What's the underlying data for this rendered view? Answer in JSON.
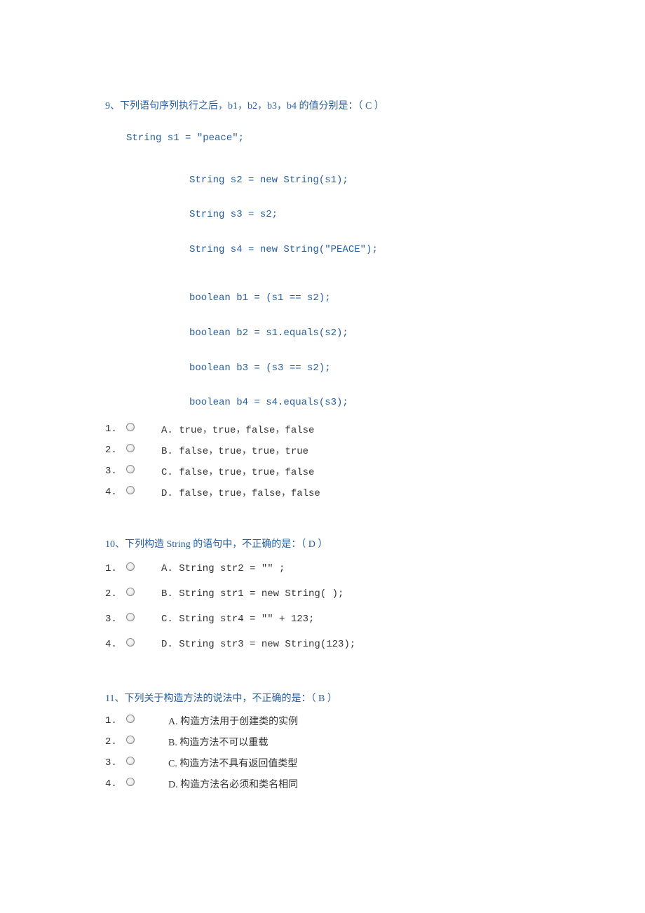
{
  "q9": {
    "title": "9、下列语句序列执行之后，b1，b2，b3，b4 的值分别是：（      C      ）",
    "code0": "String s1 = \"peace\";",
    "code1": "String s2 = new String(s1);",
    "code2": "String s3 = s2;",
    "code3": "String s4 = new String(\"PEACE\");",
    "code4": "boolean b1 = (s1 == s2);",
    "code5": "boolean b2 = s1.equals(s2);",
    "code6": "boolean b3 = (s3 == s2);",
    "code7": "boolean b4 = s4.equals(s3);",
    "options": [
      {
        "num": "1.",
        "text": "A. true，true，false，false"
      },
      {
        "num": "2.",
        "text": "B. false，true，true，true"
      },
      {
        "num": "3.",
        "text": "C. false，true，true，false"
      },
      {
        "num": "4.",
        "text": "D. false，true，false，false"
      }
    ]
  },
  "q10": {
    "title": "10、下列构造 String 的语句中，不正确的是：（     D        ）",
    "options": [
      {
        "num": "1.",
        "text": "A. String str2 = \"\" ;"
      },
      {
        "num": "2.",
        "text": "B. String str1 = new String( );"
      },
      {
        "num": "3.",
        "text": "C. String str4 = \"\" + 123;"
      },
      {
        "num": "4.",
        "text": "D. String str3 = new String(123);"
      }
    ]
  },
  "q11": {
    "title": "11、下列关于构造方法的说法中，不正确的是：（      B      ）",
    "options": [
      {
        "num": "1.",
        "text": "A. 构造方法用于创建类的实例"
      },
      {
        "num": "2.",
        "text": "B. 构造方法不可以重载"
      },
      {
        "num": "3.",
        "text": "C. 构造方法不具有返回值类型"
      },
      {
        "num": "4.",
        "text": "D. 构造方法名必须和类名相同"
      }
    ]
  }
}
